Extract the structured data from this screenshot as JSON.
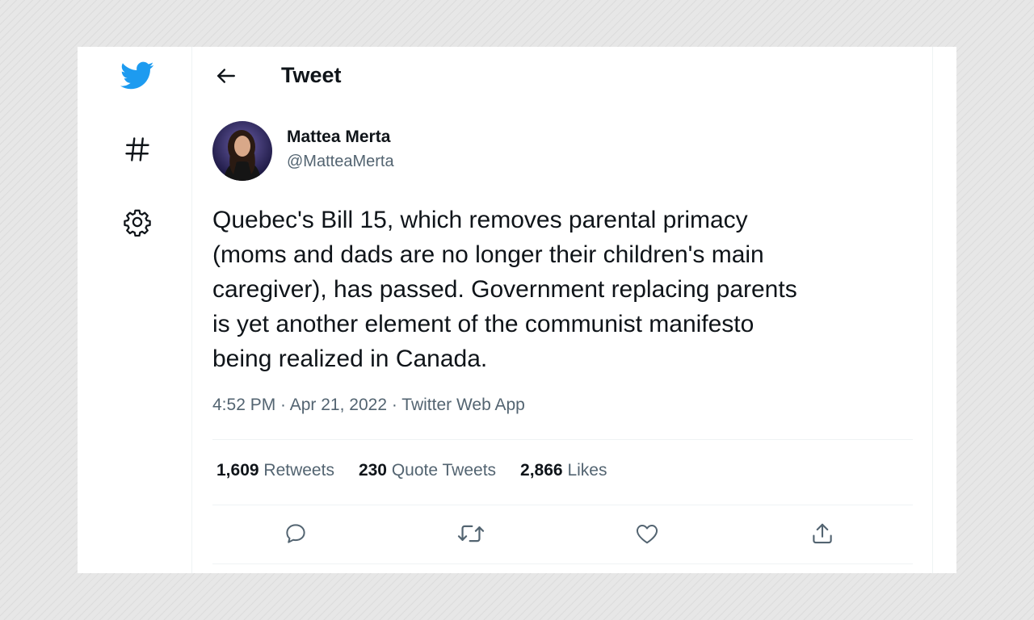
{
  "header": {
    "title": "Tweet"
  },
  "author": {
    "name": "Mattea Merta",
    "handle": "@MatteaMerta"
  },
  "tweet": {
    "text": "Quebec's Bill 15, which removes parental primacy\n(moms and dads are no longer their children's main\ncaregiver), has passed. Government replacing parents\nis yet another element of the communist manifesto\nbeing realized in Canada.",
    "time": "4:52 PM",
    "date": "Apr 21, 2022",
    "app": "Twitter Web App",
    "separator": " · "
  },
  "stats": {
    "retweets_count": "1,609",
    "retweets_label": "Retweets",
    "quotes_count": "230",
    "quotes_label": "Quote Tweets",
    "likes_count": "2,866",
    "likes_label": "Likes"
  },
  "icons": {
    "logo": "twitter-bird-icon",
    "explore": "hashtag-icon",
    "settings": "gear-icon",
    "back": "back-arrow-icon",
    "reply": "reply-icon",
    "retweet": "retweet-icon",
    "like": "heart-icon",
    "share": "share-icon"
  },
  "colors": {
    "brand": "#1d9bf0",
    "text": "#0f1419",
    "secondary": "#536471"
  }
}
